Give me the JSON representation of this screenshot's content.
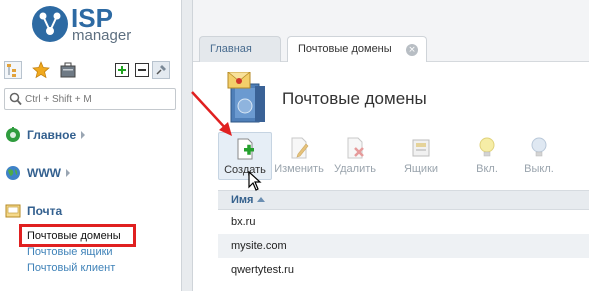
{
  "brand": {
    "line1": "ISP",
    "line2": "manager"
  },
  "sidebar": {
    "search_placeholder": "Ctrl + Shift + M",
    "groups": [
      {
        "label": "Главное"
      },
      {
        "label": "WWW"
      },
      {
        "label": "Почта"
      }
    ],
    "mail_items": [
      {
        "label": "Почтовые домены"
      },
      {
        "label": "Почтовые ящики"
      },
      {
        "label": "Почтовый клиент"
      }
    ]
  },
  "tabs": [
    {
      "label": "Главная"
    },
    {
      "label": "Почтовые домены",
      "close": "×"
    }
  ],
  "page": {
    "title": "Почтовые домены"
  },
  "toolbar": {
    "create": "Создать",
    "edit": "Изменить",
    "delete": "Удалить",
    "mailboxes": "Ящики",
    "on": "Вкл.",
    "off": "Выкл."
  },
  "table": {
    "header": "Имя",
    "rows": [
      "bx.ru",
      "mysite.com",
      "qwertytest.ru"
    ]
  },
  "colors": {
    "accent": "#2d6aa3",
    "annotation": "#e02020",
    "link": "#3f82b8"
  }
}
